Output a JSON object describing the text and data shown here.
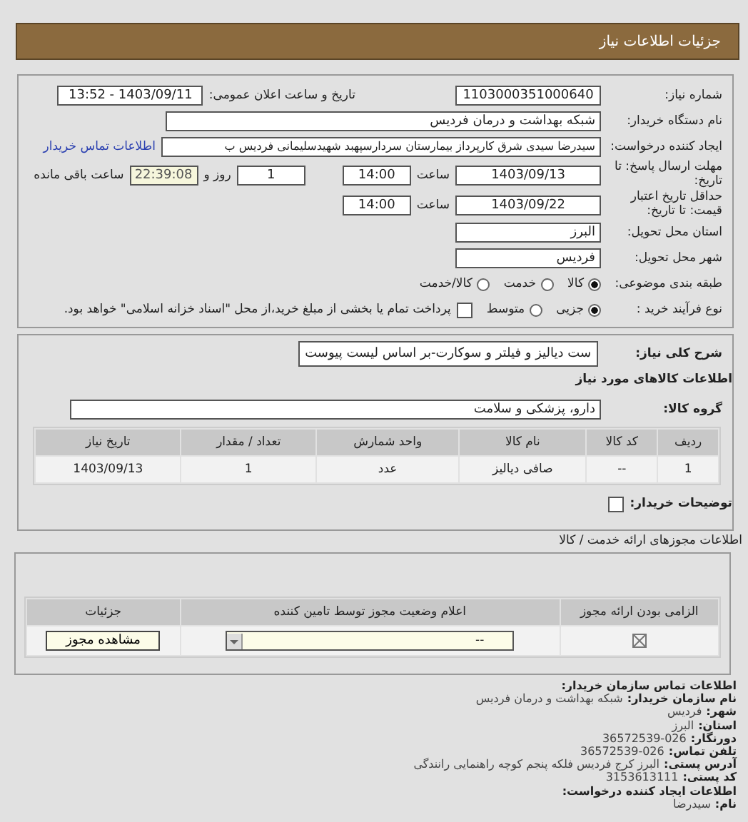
{
  "header": {
    "title": "جزئیات اطلاعات نیاز"
  },
  "need": {
    "number_label": "شماره نیاز:",
    "number": "1103000351000640",
    "announce_label": "تاریخ و ساعت اعلان عمومی:",
    "announce": "1403/09/11 - 13:52"
  },
  "buyer": {
    "label": "نام دستگاه خریدار:",
    "value": "شبکه بهداشت و درمان فردیس"
  },
  "requester": {
    "label": "ایجاد کننده درخواست:",
    "value": "سیدرضا سیدی شرق کارپرداز بیمارستان سردارسپهبد شهیدسلیمانی فردیس ب",
    "link": "اطلاعات تماس خریدار"
  },
  "deadline": {
    "label": "مهلت ارسال پاسخ: تا تاریخ:",
    "date": "1403/09/13",
    "time_label": "ساعت",
    "time": "14:00",
    "days": "1",
    "days_label": "روز و",
    "remaining": "22:39:08",
    "remaining_label": "ساعت باقی مانده"
  },
  "validity": {
    "label": "حداقل تاریخ اعتبار قیمت: تا تاریخ:",
    "date": "1403/09/22",
    "time_label": "ساعت",
    "time": "14:00"
  },
  "province": {
    "label": "استان محل تحویل:",
    "value": "البرز"
  },
  "city": {
    "label": "شهر محل تحویل:",
    "value": "فردیس"
  },
  "category": {
    "label": "طبقه بندی موضوعی:",
    "options": [
      {
        "label": "کالا",
        "selected": true
      },
      {
        "label": "خدمت",
        "selected": false
      },
      {
        "label": "کالا/خدمت",
        "selected": false
      }
    ]
  },
  "purchase": {
    "label": "نوع فرآیند خرید :",
    "options": [
      {
        "label": "جزیی",
        "selected": true
      },
      {
        "label": "متوسط",
        "selected": false
      }
    ],
    "payment": {
      "checked": false,
      "label": "پرداخت تمام یا بخشی از مبلغ خرید،از محل \"اسناد خزانه اسلامی\" خواهد بود."
    }
  },
  "description": {
    "label": "شرح کلی نیاز:",
    "value": "ست دیالیز و فیلتر و سوکارت-بر اساس لیست پیوست"
  },
  "goods_title": "اطلاعات کالاهای مورد نیاز",
  "goods_group": {
    "label": "گروه کالا:",
    "value": "دارو، پزشکی و سلامت"
  },
  "goods_table": {
    "columns": [
      "ردیف",
      "کد کالا",
      "نام کالا",
      "واحد شمارش",
      "تعداد / مقدار",
      "تاریخ نیاز"
    ],
    "rows": [
      [
        "1",
        "--",
        "صافی دیالیز",
        "عدد",
        "1",
        "1403/09/13"
      ]
    ]
  },
  "buyer_notes": {
    "label": "توضیحات خریدار:",
    "checked": false
  },
  "permits": {
    "title": "اطلاعات مجوزهای ارائه خدمت / کالا",
    "columns": [
      "الزامی بودن ارائه مجوز",
      "اعلام وضعیت مجوز توسط تامین کننده",
      "جزئیات"
    ],
    "rows": [
      {
        "required": true,
        "status": "--",
        "button": "مشاهده مجوز"
      }
    ]
  },
  "contact": [
    {
      "kind": "heading",
      "label": "اطلاعات تماس سازمان خریدار:"
    },
    {
      "kind": "field",
      "label": "نام سازمان خریدار:",
      "value": "شبکه بهداشت و درمان فردیس"
    },
    {
      "kind": "field",
      "label": "شهر:",
      "value": "فردیس"
    },
    {
      "kind": "field",
      "label": "استان:",
      "value": "البرز"
    },
    {
      "kind": "field",
      "label": "دورنگار:",
      "value": "026-36572539"
    },
    {
      "kind": "field",
      "label": "تلفن تماس:",
      "value": "026-36572539"
    },
    {
      "kind": "field",
      "label": "آدرس پستی:",
      "value": "البرز کرج فردیس فلکه پنجم کوچه راهنمایی رانندگی"
    },
    {
      "kind": "field",
      "label": "کد پستی:",
      "value": "3153613111"
    },
    {
      "kind": "heading",
      "label": "اطلاعات ایجاد کننده درخواست:"
    },
    {
      "kind": "field",
      "label": "نام:",
      "value": "سیدرضا"
    }
  ]
}
